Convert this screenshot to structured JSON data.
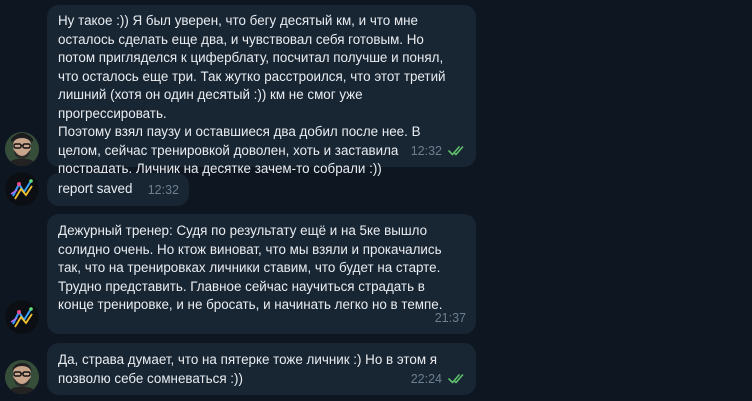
{
  "messages": [
    {
      "text": "Ну такое :)) Я был уверен, что бегу десятый км, и что мне\nосталось сделать еще два, и чувствовал себя готовым. Но\nпотом пригляделся к циферблату, посчитал получше и понял,\nчто осталось еще три. Так жутко расстроился, что этот третий\nлишний (хотя он один десятый :)) км не смог уже прогрессировать.\nПоэтому взял паузу и оставшиеся два добил после нее. В\nцелом, сейчас тренировкой доволен, хоть и заставила\nпострадать. Личник на десятке зачем-то собрали :))",
      "time": "12:32",
      "read": true,
      "avatar": "user-avatar"
    },
    {
      "text": "report saved",
      "time": "12:32",
      "read": false,
      "avatar": "bot-avatar"
    },
    {
      "text": "Дежурный тренер: Судя по результату ещё и на 5ке вышло\nсолидно очень. Но ктож виноват, что мы взяли и прокачались\nтак, что на тренировках личники ставим, что будет на старте.\nТрудно представить. Главное сейчас научиться страдать в\nконце тренировке, и не бросать, и начинать легко но в темпе.",
      "time": "21:37",
      "read": false,
      "avatar": "bot-avatar"
    },
    {
      "text": "Да, страва думает, что на пятерке тоже личник :) Но в этом я\nпозволю себе сомневаться :))",
      "time": "22:24",
      "read": true,
      "avatar": "user-avatar"
    }
  ],
  "colors": {
    "background": "#0e1621",
    "bubble": "#182533",
    "text": "#e9edf1",
    "time": "#6d7f8f",
    "read_ticks": "#5fc06c"
  }
}
